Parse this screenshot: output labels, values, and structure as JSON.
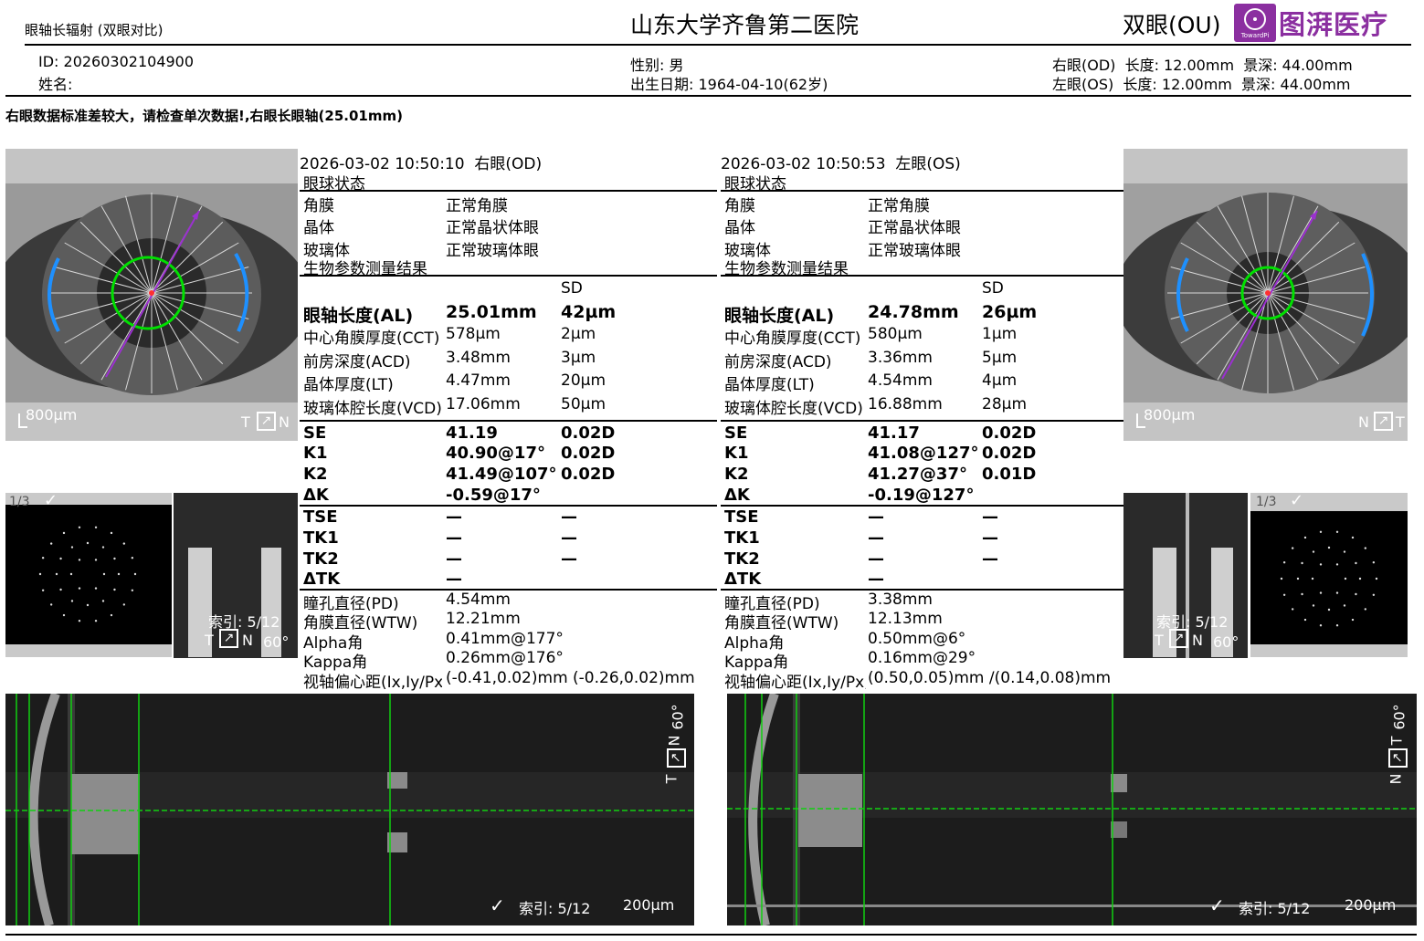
{
  "header": {
    "report_type": "眼轴长辐射 (双眼对比)",
    "hospital": "山东大学齐鲁第二医院",
    "eye_mode": "双眼(OU)",
    "logo_small": "TowardPi",
    "logo_text": "图湃医疗",
    "brand_color": "#8b2fa0"
  },
  "patient": {
    "id_line": "ID: 20260302104900",
    "name_line": "姓名: ",
    "sex_line": "性别: 男",
    "dob_line": "出生日期: 1964-04-10(62岁)",
    "od_settings": "右眼(OD)  长度: 12.00mm  景深: 44.00mm",
    "os_settings": "左眼(OS)  长度: 12.00mm  景深: 44.00mm"
  },
  "warning": "右眼数据标准差较大，请检查单次数据!,右眼长眼轴(25.01mm)",
  "od": {
    "datetime": "2026-03-02 10:50:10  右眼(OD)",
    "state_title": "眼球状态",
    "states": [
      {
        "k": "角膜",
        "v": "正常角膜"
      },
      {
        "k": "晶体",
        "v": "正常晶状体眼"
      },
      {
        "k": "玻璃体",
        "v": "正常玻璃体眼"
      }
    ],
    "bio_title": "生物参数测量结果",
    "sd_header": "SD",
    "measures": [
      {
        "k": "眼轴长度(AL)",
        "v": "25.01mm",
        "sd": "42µm"
      },
      {
        "k": "中心角膜厚度(CCT)",
        "v": "578µm",
        "sd": "2µm"
      },
      {
        "k": "前房深度(ACD)",
        "v": "3.48mm",
        "sd": "3µm"
      },
      {
        "k": "晶体厚度(LT)",
        "v": "4.47mm",
        "sd": "20µm"
      },
      {
        "k": "玻璃体腔长度(VCD)",
        "v": "17.06mm",
        "sd": "50µm"
      }
    ],
    "kera": [
      {
        "k": "SE",
        "v": "41.19",
        "sd": "0.02D"
      },
      {
        "k": "K1",
        "v": "40.90@17°",
        "sd": "0.02D"
      },
      {
        "k": "K2",
        "v": "41.49@107°",
        "sd": "0.02D"
      },
      {
        "k": "ΔK",
        "v": "-0.59@17°",
        "sd": ""
      }
    ],
    "tkera": [
      {
        "k": "TSE",
        "v": "—",
        "sd": "—"
      },
      {
        "k": "TK1",
        "v": "—",
        "sd": "—"
      },
      {
        "k": "TK2",
        "v": "—",
        "sd": "—"
      },
      {
        "k": "ΔTK",
        "v": "—",
        "sd": ""
      }
    ],
    "extra": [
      {
        "k": "瞳孔直径(PD)",
        "v": "4.54mm"
      },
      {
        "k": "角膜直径(WTW)",
        "v": "12.21mm"
      },
      {
        "k": "Alpha角",
        "v": "0.41mm@177°"
      },
      {
        "k": "Kappa角",
        "v": "0.26mm@176°"
      },
      {
        "k": "视轴偏心距(Ix,Iy/Px,I",
        "v": "(-0.41,0.02)mm (-0.26,0.02)mm"
      }
    ],
    "scale_label": "800µm",
    "orient": "T",
    "orient2": "N",
    "kera_count": "1/3",
    "index_label": "索引: 5/12",
    "angle_label": "60°",
    "scan_index": "索引: 5/12",
    "scan_scale": "200µm"
  },
  "os": {
    "datetime": "2026-03-02 10:50:53  左眼(OS)",
    "state_title": "眼球状态",
    "states": [
      {
        "k": "角膜",
        "v": "正常角膜"
      },
      {
        "k": "晶体",
        "v": "正常晶状体眼"
      },
      {
        "k": "玻璃体",
        "v": "正常玻璃体眼"
      }
    ],
    "bio_title": "生物参数测量结果",
    "sd_header": "SD",
    "measures": [
      {
        "k": "眼轴长度(AL)",
        "v": "24.78mm",
        "sd": "26µm"
      },
      {
        "k": "中心角膜厚度(CCT)",
        "v": "580µm",
        "sd": "1µm"
      },
      {
        "k": "前房深度(ACD)",
        "v": "3.36mm",
        "sd": "5µm"
      },
      {
        "k": "晶体厚度(LT)",
        "v": "4.54mm",
        "sd": "4µm"
      },
      {
        "k": "玻璃体腔长度(VCD)",
        "v": "16.88mm",
        "sd": "28µm"
      }
    ],
    "kera": [
      {
        "k": "SE",
        "v": "41.17",
        "sd": "0.02D"
      },
      {
        "k": "K1",
        "v": "41.08@127°",
        "sd": "0.02D"
      },
      {
        "k": "K2",
        "v": "41.27@37°",
        "sd": "0.01D"
      },
      {
        "k": "ΔK",
        "v": "-0.19@127°",
        "sd": ""
      }
    ],
    "tkera": [
      {
        "k": "TSE",
        "v": "—",
        "sd": "—"
      },
      {
        "k": "TK1",
        "v": "—",
        "sd": "—"
      },
      {
        "k": "TK2",
        "v": "—",
        "sd": "—"
      },
      {
        "k": "ΔTK",
        "v": "—",
        "sd": ""
      }
    ],
    "extra": [
      {
        "k": "瞳孔直径(PD)",
        "v": "3.38mm"
      },
      {
        "k": "角膜直径(WTW)",
        "v": "12.13mm"
      },
      {
        "k": "Alpha角",
        "v": "0.50mm@6°"
      },
      {
        "k": "Kappa角",
        "v": "0.16mm@29°"
      },
      {
        "k": "视轴偏心距(Ix,Iy/Px,I",
        "v": "(0.50,0.05)mm /(0.14,0.08)mm"
      }
    ],
    "scale_label": "800µm",
    "orient": "N",
    "orient2": "T",
    "kera_count": "1/3",
    "index_label": "索引: 5/12",
    "angle_label": "60°",
    "scan_index": "索引: 5/12",
    "scan_scale": "200µm"
  }
}
